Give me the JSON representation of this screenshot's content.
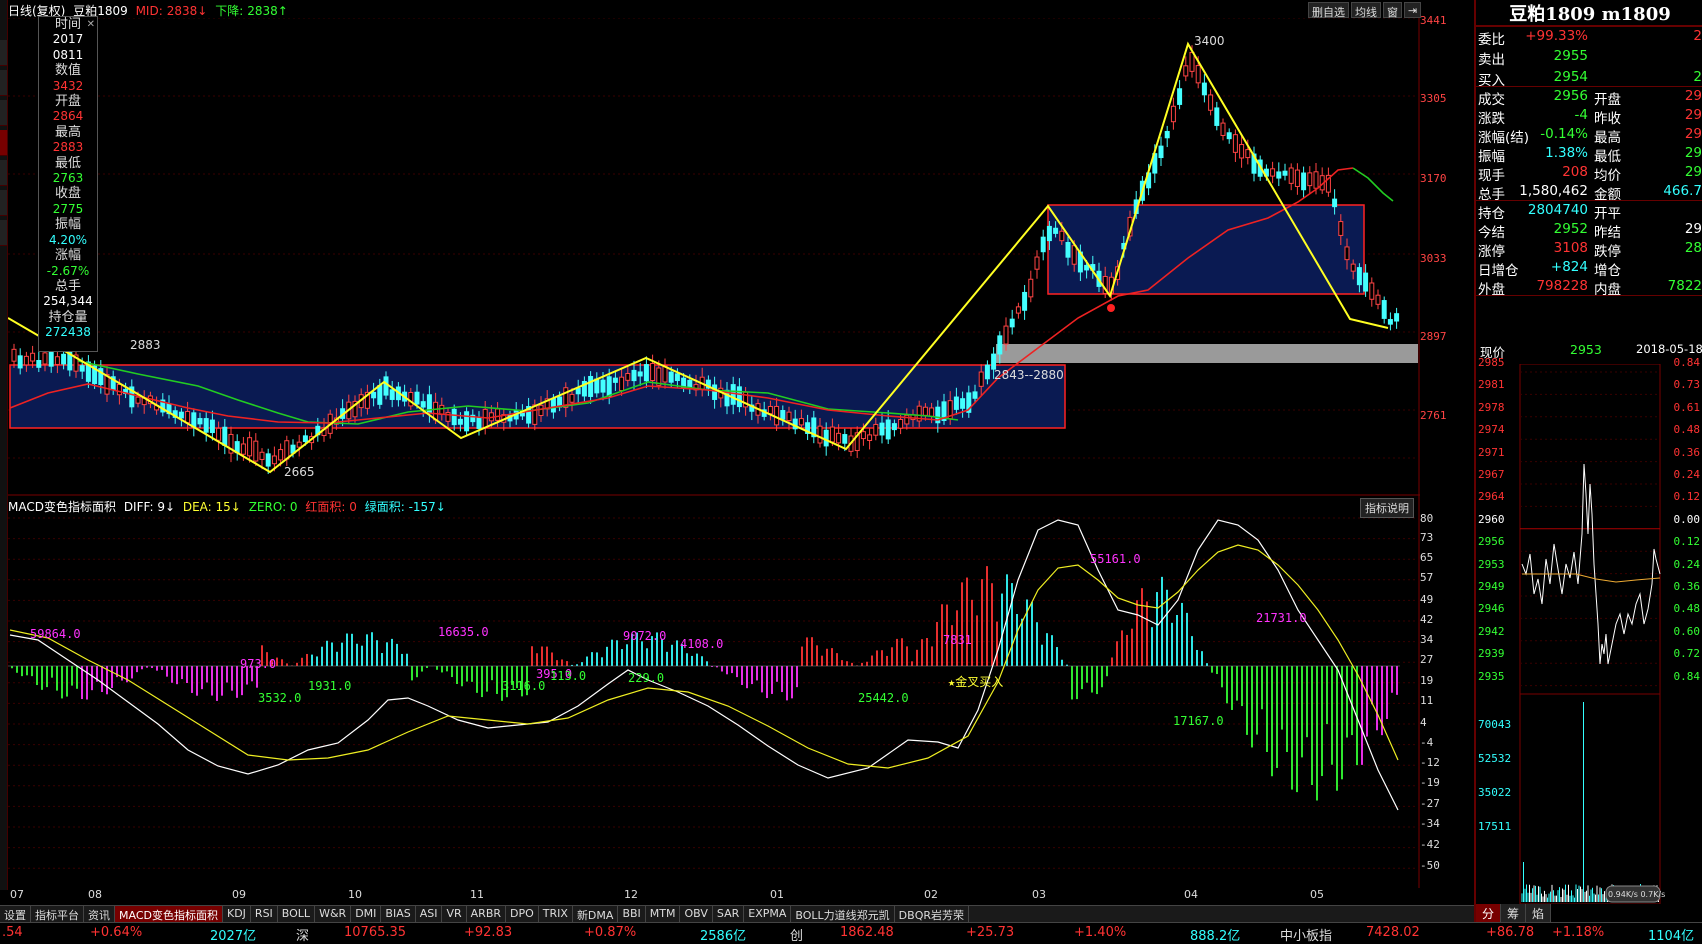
{
  "main_header": {
    "title": "日线(复权)",
    "symbol": "豆粕1809",
    "mid_label": "MID:",
    "mid_value": "2838↓",
    "down_label": "下降:",
    "down_value": "2838↑"
  },
  "header_buttons": [
    "删自选",
    "均线",
    "窗",
    "⇥"
  ],
  "info_box": {
    "items": [
      {
        "label": "时间",
        "value": "2017"
      },
      {
        "label": "",
        "value": "0811"
      },
      {
        "label": "数值",
        "value": "3432"
      },
      {
        "label": "开盘",
        "value": "2864"
      },
      {
        "label": "最高",
        "value": "2883"
      },
      {
        "label": "最低",
        "value": "2763"
      },
      {
        "label": "收盘",
        "value": "2775"
      },
      {
        "label": "振幅",
        "value": "4.20%"
      },
      {
        "label": "涨幅",
        "value": "-2.67%"
      },
      {
        "label": "总手",
        "value": "254,344"
      },
      {
        "label": "持仓量",
        "value": "272438"
      }
    ]
  },
  "main_axis": [
    "3441",
    "3305",
    "3170",
    "3033",
    "2897",
    "2761"
  ],
  "annotations": {
    "high_label": "3400",
    "low_label": "2665",
    "left_high": "2883",
    "range_label": "2843--2880"
  },
  "macd_header": {
    "name": "MACD变色指标面积",
    "diff": "DIFF: 9↓",
    "dea": "DEA: 15↓",
    "zero": "ZERO: 0",
    "red_area": "红面积: 0",
    "green_area": "绿面积: -157↓",
    "help": "指标说明"
  },
  "macd_axis": [
    "80",
    "73",
    "65",
    "57",
    "49",
    "42",
    "34",
    "27",
    "19",
    "11",
    "4",
    "-4",
    "-12",
    "-19",
    "-27",
    "-34",
    "-42",
    "-50"
  ],
  "macd_labels": [
    {
      "text": "59864.0",
      "color": "#ff33ff"
    },
    {
      "text": "3532.0",
      "color": "#33ff33"
    },
    {
      "text": "1931.0",
      "color": "#33ff33"
    },
    {
      "text": "973.0",
      "color": "#ff33ff"
    },
    {
      "text": "16635.0",
      "color": "#ff33ff"
    },
    {
      "text": "3116.0",
      "color": "#33ff33"
    },
    {
      "text": "395.0",
      "color": "#ff33ff"
    },
    {
      "text": "113.0",
      "color": "#33ff33"
    },
    {
      "text": "9072.0",
      "color": "#ff33ff"
    },
    {
      "text": "229.0",
      "color": "#33ff33"
    },
    {
      "text": "4108.0",
      "color": "#ff33ff"
    },
    {
      "text": "25442.0",
      "color": "#33ff33"
    },
    {
      "text": "7831",
      "color": "#ff33ff"
    },
    {
      "text": "★金叉买入",
      "color": "#ffff33"
    },
    {
      "text": "55161.0",
      "color": "#ff33ff"
    },
    {
      "text": "17167.0",
      "color": "#33ff33"
    },
    {
      "text": "21731.0",
      "color": "#ff33ff"
    }
  ],
  "months": [
    "07",
    "08",
    "09",
    "10",
    "11",
    "12",
    "01",
    "02",
    "03",
    "04",
    "05"
  ],
  "tabs": [
    "设置",
    "指标平台",
    "资讯",
    "MACD变色指标面积",
    "KDJ",
    "RSI",
    "BOLL",
    "W&R",
    "DMI",
    "BIAS",
    "ASI",
    "VR",
    "ARBR",
    "DPO",
    "TRIX",
    "新DMA",
    "BBI",
    "MTM",
    "OBV",
    "SAR",
    "EXPMA",
    "BOLL力道线郑元凯",
    "DBQR岩芳荣"
  ],
  "active_tab": "MACD变色指标面积",
  "ticker": [
    {
      "text": ".54",
      "color": "#ff3333"
    },
    {
      "text": "+0.64%",
      "color": "#ff3333"
    },
    {
      "text": "2027亿",
      "color": "#33ffff"
    },
    {
      "text": "深",
      "color": "#dddddd"
    },
    {
      "text": "10765.35",
      "color": "#ff3333"
    },
    {
      "text": "+92.83",
      "color": "#ff3333"
    },
    {
      "text": "+0.87%",
      "color": "#ff3333"
    },
    {
      "text": "2586亿",
      "color": "#33ffff"
    },
    {
      "text": "创",
      "color": "#dddddd"
    },
    {
      "text": "1862.48",
      "color": "#ff3333"
    },
    {
      "text": "+25.73",
      "color": "#ff3333"
    },
    {
      "text": "+1.40%",
      "color": "#ff3333"
    },
    {
      "text": "888.2亿",
      "color": "#33ffff"
    },
    {
      "text": "中小板指",
      "color": "#dddddd"
    },
    {
      "text": "7428.02",
      "color": "#ff3333"
    },
    {
      "text": "+86.78",
      "color": "#ff3333"
    },
    {
      "text": "+1.18%",
      "color": "#ff3333"
    },
    {
      "text": "1104亿",
      "color": "#33ffff"
    }
  ],
  "right_panel": {
    "title": "豆粕1809 m1809",
    "rows": [
      {
        "label": "委比",
        "v1": "+99.33%",
        "v1c": "#ff3333",
        "label2": "",
        "v2": "2",
        "v2c": "#ff3333"
      },
      {
        "label": "卖出",
        "v1": "2955",
        "v1c": "#33ff33",
        "label2": "",
        "v2": "",
        "v2c": "#ffffff"
      },
      {
        "label": "买入",
        "v1": "2954",
        "v1c": "#33ff33",
        "label2": "",
        "v2": "2",
        "v2c": "#33ff33"
      },
      {
        "label": "成交",
        "v1": "2956",
        "v1c": "#33ff33",
        "label2": "开盘",
        "v2": "29",
        "v2c": "#ff3333"
      },
      {
        "label": "涨跌",
        "v1": "-4",
        "v1c": "#33ff33",
        "label2": "昨收",
        "v2": "29",
        "v2c": "#ff3333"
      },
      {
        "label": "涨幅(结)",
        "v1": "-0.14%",
        "v1c": "#33ff33",
        "label2": "最高",
        "v2": "29",
        "v2c": "#ff3333"
      },
      {
        "label": "振幅",
        "v1": "1.38%",
        "v1c": "#33ffff",
        "label2": "最低",
        "v2": "29",
        "v2c": "#33ff33"
      },
      {
        "label": "现手",
        "v1": "208",
        "v1c": "#ff3333",
        "label2": "均价",
        "v2": "29",
        "v2c": "#33ff33"
      },
      {
        "label": "总手",
        "v1": "1,580,462",
        "v1c": "#ffffff",
        "label2": "金额",
        "v2": "466.7",
        "v2c": "#33ffff"
      },
      {
        "label": "持仓",
        "v1": "2804740",
        "v1c": "#33ffff",
        "label2": "开平",
        "v2": "",
        "v2c": "#ffffff"
      },
      {
        "label": "今结",
        "v1": "2952",
        "v1c": "#33ff33",
        "label2": "昨结",
        "v2": "29",
        "v2c": "#ffffff"
      },
      {
        "label": "涨停",
        "v1": "3108",
        "v1c": "#ff3333",
        "label2": "跌停",
        "v2": "28",
        "v2c": "#33ff33"
      },
      {
        "label": "日增仓",
        "v1": "+824",
        "v1c": "#33ffff",
        "label2": "增仓",
        "v2": "",
        "v2c": "#ffffff"
      },
      {
        "label": "外盘",
        "v1": "798228",
        "v1c": "#ff3333",
        "label2": "内盘",
        "v2": "7822",
        "v2c": "#33ff33"
      }
    ],
    "price_label": "现价",
    "price_value": "2953",
    "date": "2018-05-18",
    "mini_left": [
      "2985",
      "2981",
      "2978",
      "2974",
      "2971",
      "2967",
      "2964",
      "2960",
      "2956",
      "2953",
      "2949",
      "2946",
      "2942",
      "2939",
      "2935"
    ],
    "mini_right": [
      "0.84",
      "0.73",
      "0.61",
      "0.48",
      "0.36",
      "0.24",
      "0.12",
      "0.00",
      "0.12",
      "0.24",
      "0.36",
      "0.48",
      "0.60",
      "0.72",
      "0.84"
    ],
    "vol_left": [
      "70043",
      "52532",
      "35022",
      "17511"
    ],
    "mini_tabs": [
      "分",
      "筹",
      "焰"
    ],
    "vol_badge": "0.94K/s 0.7K/s"
  }
}
